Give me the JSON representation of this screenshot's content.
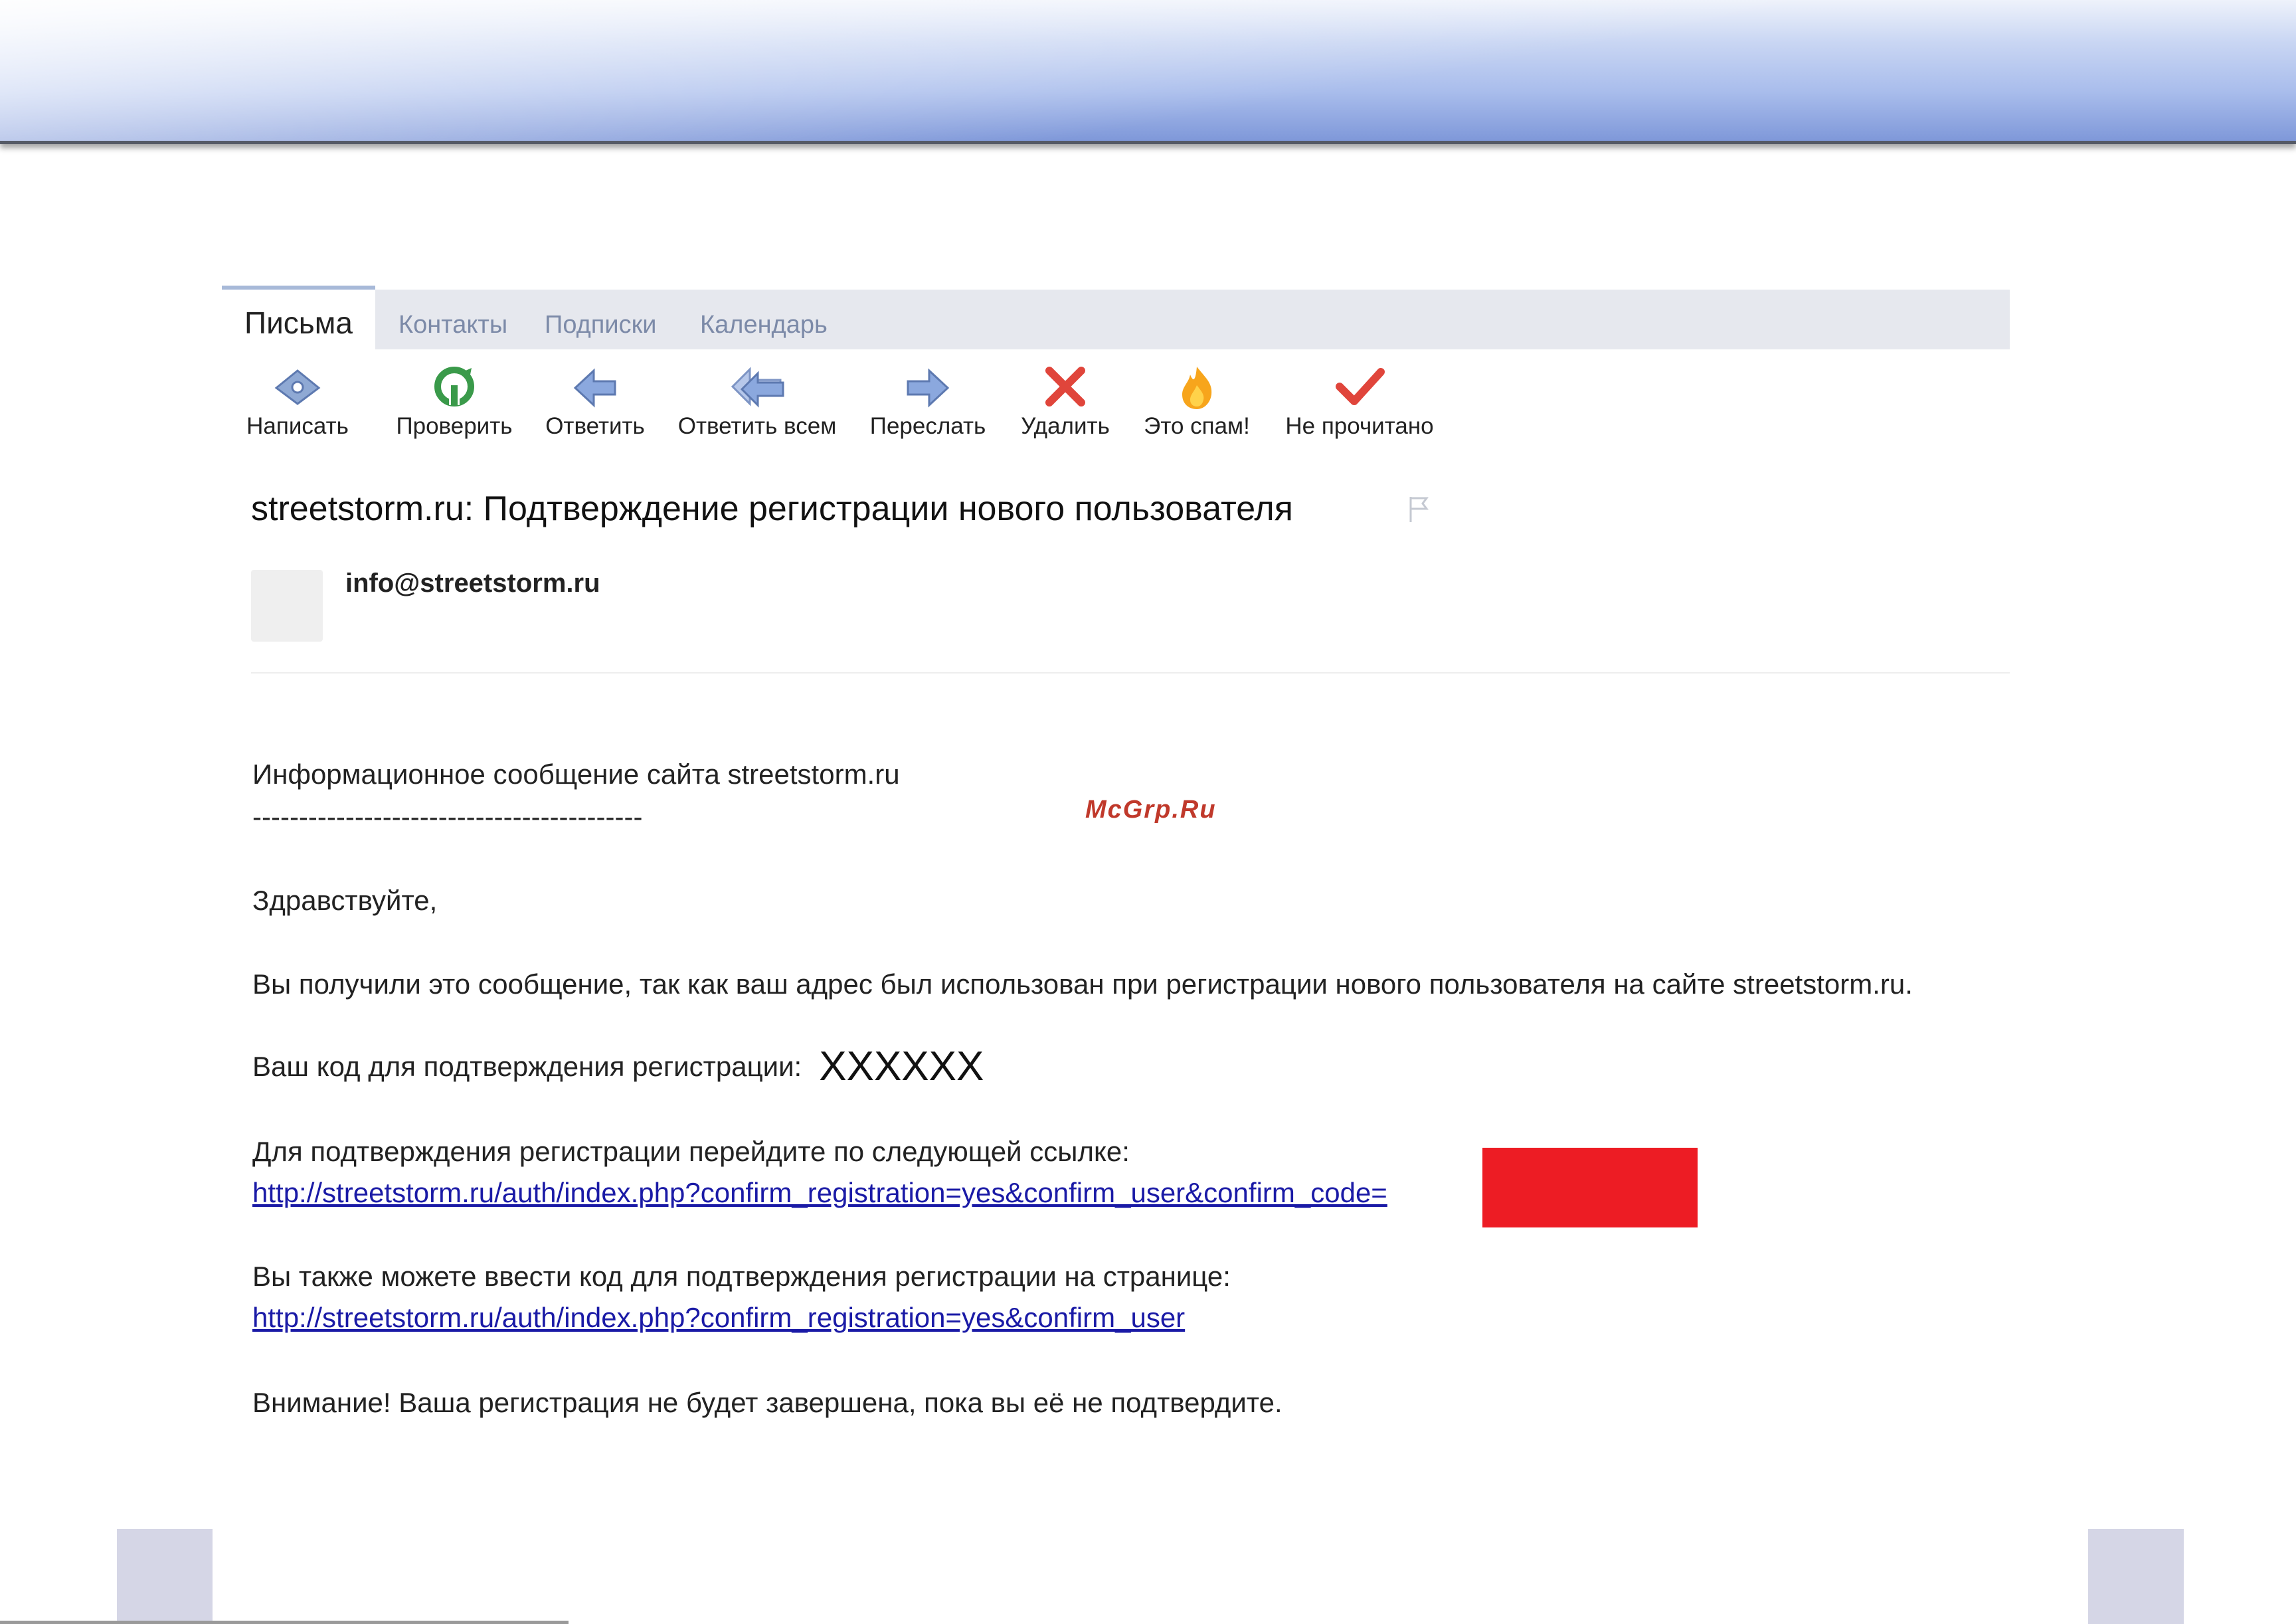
{
  "tabs": [
    "Письма",
    "Контакты",
    "Подписки",
    "Календарь"
  ],
  "toolbar": [
    {
      "label": "Написать",
      "icon": "compose-icon"
    },
    {
      "label": "Проверить",
      "icon": "refresh-icon"
    },
    {
      "label": "Ответить",
      "icon": "reply-icon"
    },
    {
      "label": "Ответить всем",
      "icon": "reply-all-icon"
    },
    {
      "label": "Переслать",
      "icon": "forward-icon"
    },
    {
      "label": "Удалить",
      "icon": "delete-icon"
    },
    {
      "label": "Это спам!",
      "icon": "spam-flame-icon"
    },
    {
      "label": "Не прочитано",
      "icon": "checkmark-icon"
    }
  ],
  "message": {
    "subject": "streetstorm.ru: Подтверждение регистрации нового пользователя",
    "sender": "info@streetstorm.ru",
    "lines": {
      "info": "Информационное сообщение сайта streetstorm.ru",
      "dashes": "------------------------------------------",
      "greeting": "Здравствуйте,",
      "reason": "Вы получили это сообщение, так как ваш адрес был использован при регистрации нового пользователя на сайте streetstorm.ru.",
      "code_label": "Ваш код для подтверждения регистрации:",
      "code": "XXXXXX",
      "confirm_label": "Для подтверждения регистрации перейдите по следующей ссылке:",
      "confirm_link": "http://streetstorm.ru/auth/index.php?confirm_registration=yes&confirm_user&confirm_code=",
      "page_label": "Вы также можете ввести код для подтверждения регистрации на странице:",
      "page_link": "http://streetstorm.ru/auth/index.php?confirm_registration=yes&confirm_user",
      "warning": "Внимание! Ваша регистрация не будет завершена, пока вы её не подтвердите."
    }
  },
  "watermark": "McGrp.Ru",
  "colors": {
    "link": "#1a1aa6",
    "redact": "#ed1c24",
    "banner": "#a9bdec"
  }
}
